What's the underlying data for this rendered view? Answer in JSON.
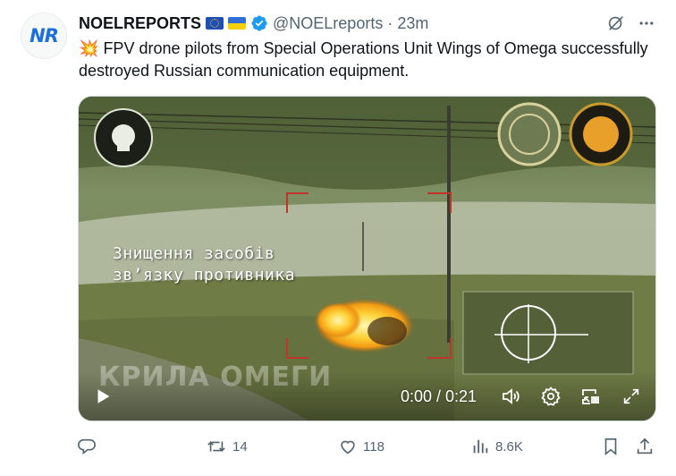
{
  "post": {
    "avatar_text": "NR",
    "author_name": "NOELREPORTS",
    "handle": "@NOELreports",
    "separator": "·",
    "time": "23m",
    "body": "FPV drone pilots from Special Operations Unit Wings of Omega successfully destroyed Russian communication equipment.",
    "emoji": "💥"
  },
  "video": {
    "caption_line1": "Знищення засобів",
    "caption_line2": "зв’язку противника",
    "watermark": "КРИЛА ОМЕГИ",
    "time_display": "0:00 / 0:21",
    "progress": 0.0
  },
  "actions": {
    "replies": "",
    "reposts": "14",
    "likes": "118",
    "views": "8.6K"
  },
  "icons": {
    "grok": "grok-icon",
    "more": "more-icon",
    "play": "play-icon",
    "volume": "volume-icon",
    "settings": "settings-icon",
    "pip": "picture-in-picture-icon",
    "fullscreen": "fullscreen-icon",
    "reply": "reply-icon",
    "repost": "repost-icon",
    "like": "like-icon",
    "views": "views-icon",
    "bookmark": "bookmark-icon",
    "share": "share-icon"
  },
  "colors": {
    "text": "#0f1419",
    "secondary": "#536471",
    "verified": "#1d9bf0",
    "border": "#cfd9de"
  }
}
